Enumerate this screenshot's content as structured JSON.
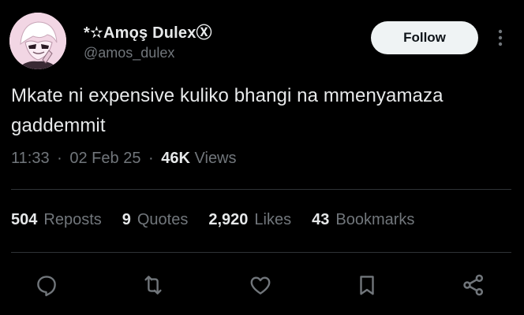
{
  "author": {
    "display_name": "*✫Amǫş DulexⓍ",
    "handle": "@amos_dulex"
  },
  "follow_button": {
    "label": "Follow"
  },
  "tweet": {
    "text": "Mkate ni expensive kuliko bhangi na mmenyamaza gaddemmit",
    "time": "11:33",
    "date": "02 Feb 25",
    "views_count": "46K",
    "views_label": "Views",
    "separator": "·"
  },
  "stats": [
    {
      "count": "504",
      "label": "Reposts"
    },
    {
      "count": "9",
      "label": "Quotes"
    },
    {
      "count": "2,920",
      "label": "Likes"
    },
    {
      "count": "43",
      "label": "Bookmarks"
    }
  ],
  "actions": [
    {
      "icon": "reply-icon"
    },
    {
      "icon": "repost-icon"
    },
    {
      "icon": "like-icon"
    },
    {
      "icon": "bookmark-icon"
    },
    {
      "icon": "share-icon"
    }
  ],
  "colors": {
    "background": "#000000",
    "primary_text": "#e7e9ea",
    "secondary_text": "#71767b",
    "divider": "#2f3336",
    "follow_bg": "#eff3f4"
  }
}
